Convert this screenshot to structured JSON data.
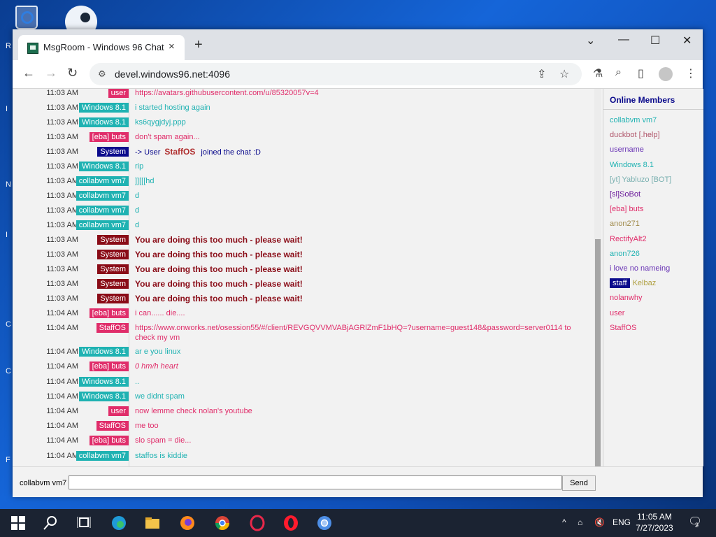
{
  "desktop": {
    "left_letters": [
      "R",
      "I",
      "N",
      "I",
      "C",
      "C",
      "F"
    ]
  },
  "browser": {
    "tab_title": "MsgRoom - Windows 96 Chat",
    "tab_close": "×",
    "new_tab": "+",
    "controls": {
      "dropdown": "⌄",
      "minimize": "—",
      "maximize": "☐",
      "close": "✕"
    },
    "url": "devel.windows96.net:4096"
  },
  "chat": {
    "messages": [
      {
        "time": "11:03 AM",
        "user": "user",
        "user_color": "#e02d6a",
        "text": "https://avatars.githubusercontent.com/u/85320057v=4",
        "style": "pink"
      },
      {
        "time": "11:03 AM",
        "user": "Windows 8.1",
        "user_color": "#1fb2b2",
        "text": "i started hosting again",
        "style": "cyan"
      },
      {
        "time": "11:03 AM",
        "user": "Windows 8.1",
        "user_color": "#1fb2b2",
        "text": "ks6qygjdyj.ppp",
        "style": "cyan"
      },
      {
        "time": "11:03 AM",
        "user": "[eba] buts",
        "user_color": "#e02d6a",
        "text": "don't spam again...",
        "style": "pink"
      },
      {
        "time": "11:03 AM",
        "user": "System",
        "user_color": "#0b0b8c",
        "text_prefix": "-> User",
        "text_user": "StaffOS",
        "text_suffix": "joined the chat :D",
        "style": "system-join"
      },
      {
        "time": "11:03 AM",
        "user": "Windows 8.1",
        "user_color": "#1fb2b2",
        "text": "rip",
        "style": "cyan"
      },
      {
        "time": "11:03 AM",
        "user": "collabvm vm7",
        "user_color": "#1fb2b2",
        "text": "]][[[hd",
        "style": "cyan"
      },
      {
        "time": "11:03 AM",
        "user": "collabvm vm7",
        "user_color": "#1fb2b2",
        "text": "d",
        "style": "cyan"
      },
      {
        "time": "11:03 AM",
        "user": "collabvm vm7",
        "user_color": "#1fb2b2",
        "text": "d",
        "style": "cyan"
      },
      {
        "time": "11:03 AM",
        "user": "collabvm vm7",
        "user_color": "#1fb2b2",
        "text": "d",
        "style": "cyan"
      },
      {
        "time": "11:03 AM",
        "user": "System",
        "user_color": "#8a0c17",
        "text": "You are doing this too much - please wait!",
        "style": "red"
      },
      {
        "time": "11:03 AM",
        "user": "System",
        "user_color": "#8a0c17",
        "text": "You are doing this too much - please wait!",
        "style": "red"
      },
      {
        "time": "11:03 AM",
        "user": "System",
        "user_color": "#8a0c17",
        "text": "You are doing this too much - please wait!",
        "style": "red"
      },
      {
        "time": "11:03 AM",
        "user": "System",
        "user_color": "#8a0c17",
        "text": "You are doing this too much - please wait!",
        "style": "red"
      },
      {
        "time": "11:03 AM",
        "user": "System",
        "user_color": "#8a0c17",
        "text": "You are doing this too much - please wait!",
        "style": "red"
      },
      {
        "time": "11:04 AM",
        "user": "[eba] buts",
        "user_color": "#e02d6a",
        "text": "i can...... die....",
        "style": "pink"
      },
      {
        "time": "11:04 AM",
        "user": "StaffOS",
        "user_color": "#e02d6a",
        "text": "https://www.onworks.net/osession55/#/client/REVGQVVMVABjAGRlZmF1bHQ=?username=guest148&password=server0114 to check my vm",
        "style": "pink",
        "tall": true
      },
      {
        "time": "11:04 AM",
        "user": "Windows 8.1",
        "user_color": "#1fb2b2",
        "text": "ar e you linux",
        "style": "cyan"
      },
      {
        "time": "11:04 AM",
        "user": "[eba] buts",
        "user_color": "#e02d6a",
        "text": "0 hm/h heart",
        "style": "pink-italic"
      },
      {
        "time": "11:04 AM",
        "user": "Windows 8.1",
        "user_color": "#1fb2b2",
        "text": "..",
        "style": "cyan"
      },
      {
        "time": "11:04 AM",
        "user": "Windows 8.1",
        "user_color": "#1fb2b2",
        "text": "we didnt spam",
        "style": "cyan"
      },
      {
        "time": "11:04 AM",
        "user": "user",
        "user_color": "#e02d6a",
        "text": "now lemme check nolan's youtube",
        "style": "pink"
      },
      {
        "time": "11:04 AM",
        "user": "StaffOS",
        "user_color": "#e02d6a",
        "text": "me too",
        "style": "pink"
      },
      {
        "time": "11:04 AM",
        "user": "[eba] buts",
        "user_color": "#e02d6a",
        "text": "slo spam = die...",
        "style": "pink"
      },
      {
        "time": "11:04 AM",
        "user": "collabvm vm7",
        "user_color": "#1fb2b2",
        "text": "staffos is kiddie",
        "style": "cyan"
      }
    ],
    "nickname": "collabvm vm7",
    "input_value": "",
    "send_label": "Send"
  },
  "members": {
    "title": "Online Members",
    "staff_badge": "staff",
    "list": [
      {
        "name": "collabvm vm7",
        "color": "#1fb2b2"
      },
      {
        "name": "duckbot [.help]",
        "color": "#b0556a"
      },
      {
        "name": "username",
        "color": "#6a35b5"
      },
      {
        "name": "Windows 8.1",
        "color": "#1fb2b2"
      },
      {
        "name": "[yt] Yabluzo [BOT]",
        "color": "#7ab0b0"
      },
      {
        "name": "[sl]SoBot",
        "color": "#6a1a9a"
      },
      {
        "name": "[eba] buts",
        "color": "#e02d6a"
      },
      {
        "name": "anon271",
        "color": "#a08a4a"
      },
      {
        "name": "RectifyAlt2",
        "color": "#e02d6a"
      },
      {
        "name": "anon726",
        "color": "#1fb2b2"
      },
      {
        "name": "i love no nameing",
        "color": "#6a35b5"
      },
      {
        "name": "Kelbaz",
        "color": "#b0a040",
        "staff": true
      },
      {
        "name": "nolanwhy",
        "color": "#e02d6a"
      },
      {
        "name": "user",
        "color": "#e02d6a"
      },
      {
        "name": "StaffOS",
        "color": "#e02d6a"
      }
    ]
  },
  "taskbar": {
    "lang": "ENG",
    "time": "11:05 AM",
    "date": "7/27/2023",
    "notifications": "2"
  }
}
